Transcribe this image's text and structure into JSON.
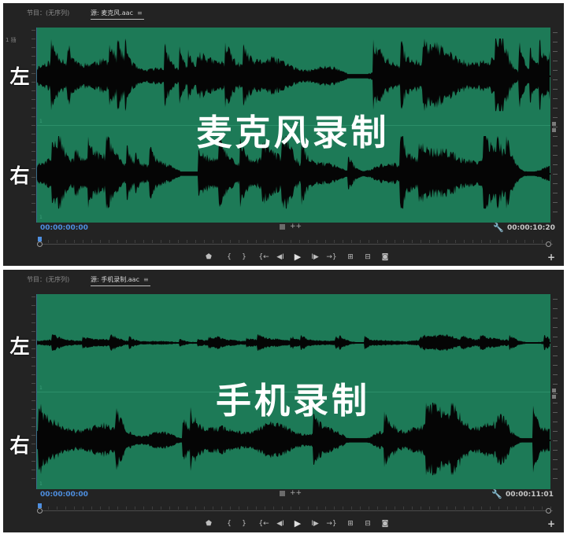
{
  "panels": [
    {
      "tab_program": "节目：(无序列)",
      "tab_source": "源: 麦克风.aac",
      "tab_menu_icon": "hamburger-icon",
      "side_label": "1 插",
      "left_label": "左",
      "right_label": "右",
      "overlay_title": "麦克风录制",
      "timecode_current": "00:00:00:00",
      "timecode_duration": "00:00:10:20",
      "waveform": {
        "left_amplitude": "high",
        "right_amplitude": "high",
        "seed": 11
      }
    },
    {
      "tab_program": "节目：(无序列)",
      "tab_source": "源: 手机录制.aac",
      "tab_menu_icon": "hamburger-icon",
      "side_label": "",
      "left_label": "左",
      "right_label": "右",
      "overlay_title": "手机录制",
      "timecode_current": "00:00:00:00",
      "timecode_duration": "00:00:11:01",
      "waveform": {
        "left_amplitude": "low",
        "right_amplitude": "high",
        "seed": 29
      }
    }
  ],
  "colors": {
    "waveform_bg": "#1d7a57",
    "waveform_fill": "#050505",
    "timecode_current": "#4e8fe0",
    "panel_bg": "#232323"
  },
  "controls": [
    {
      "name": "add-marker-button",
      "icon": "marker-icon",
      "glyph": "⬟"
    },
    {
      "name": "mark-in-button",
      "icon": "mark-in-icon",
      "glyph": "{"
    },
    {
      "name": "mark-out-button",
      "icon": "mark-out-icon",
      "glyph": "}"
    },
    {
      "name": "go-to-in-button",
      "icon": "go-to-in-icon",
      "glyph": "{←"
    },
    {
      "name": "step-back-button",
      "icon": "step-back-icon",
      "glyph": "◀I"
    },
    {
      "name": "play-button",
      "icon": "play-icon",
      "glyph": "▶"
    },
    {
      "name": "step-forward-button",
      "icon": "step-forward-icon",
      "glyph": "I▶"
    },
    {
      "name": "go-to-out-button",
      "icon": "go-to-out-icon",
      "glyph": "→}"
    },
    {
      "name": "insert-button",
      "icon": "insert-icon",
      "glyph": "⊞"
    },
    {
      "name": "overwrite-button",
      "icon": "overwrite-icon",
      "glyph": "⊟"
    },
    {
      "name": "export-frame-button",
      "icon": "camera-icon",
      "glyph": "◙"
    }
  ],
  "icons": {
    "wrench": "wrench-icon",
    "add": "plus-icon",
    "drag_video": "square-icon",
    "drag_audio": "audio-drag-icon"
  }
}
